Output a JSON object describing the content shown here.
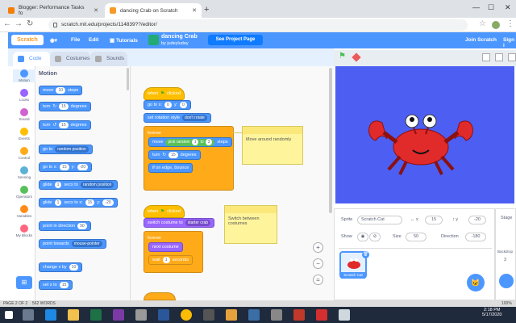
{
  "browser": {
    "tabs": [
      {
        "label": "Blogger: Performance Tasks fo"
      },
      {
        "label": "dancing Crab on Scratch"
      }
    ],
    "new_tab": "+",
    "url": "scratch.mit.edu/projects/114839??/editor/"
  },
  "scratch": {
    "logo": "Scratch",
    "menu": {
      "file": "File",
      "edit": "Edit",
      "tutorials": "Tutorials",
      "join": "Join Scratch",
      "signin": "Sign i"
    },
    "project_title": "dancing Crab",
    "project_author": "by judeyludey",
    "see_project": "See Project Page",
    "tabs": {
      "code": "Code",
      "costumes": "Costumes",
      "sounds": "Sounds"
    },
    "categories": [
      {
        "label": "Motion",
        "color": "#4c97ff"
      },
      {
        "label": "Looks",
        "color": "#9966ff"
      },
      {
        "label": "Sound",
        "color": "#cf63cf"
      },
      {
        "label": "Events",
        "color": "#ffbf00"
      },
      {
        "label": "Control",
        "color": "#ffab19"
      },
      {
        "label": "Sensing",
        "color": "#5cb1d6"
      },
      {
        "label": "Operators",
        "color": "#59c059"
      },
      {
        "label": "Variables",
        "color": "#ff8c1a"
      },
      {
        "label": "My Blocks",
        "color": "#ff6680"
      }
    ],
    "palette_title": "Motion",
    "palette": {
      "move": "move",
      "move_val": "10",
      "steps": "steps",
      "turn": "turn",
      "turn_r": "15",
      "degrees": "degrees",
      "turn_l_val": "15",
      "goto": "go to",
      "goto_dd": "random position",
      "gotoxy": "go to x:",
      "gx": "15",
      "y": "y:",
      "gy": "-20",
      "glide": "glide",
      "glide_s": "1",
      "secs_to": "secs to",
      "glide_dd": "random position",
      "glide2": "glide",
      "glide2_s": "1",
      "secs_to_x": "secs to x:",
      "g2x": "15",
      "g2y": "-20",
      "point_dir": "point in direction",
      "point_val": "90",
      "point_towards": "point towards",
      "pt_dd": "mouse-pointer",
      "change_x": "change x by",
      "cx": "10",
      "set_x": "set x to",
      "sx": "15"
    },
    "script1": {
      "hat": "when",
      "hat2": "clicked",
      "goto": "go to x:",
      "x": "0",
      "y": "y:",
      "yv": "0",
      "rot": "set rotation style",
      "rot_dd": "don't rotate",
      "forever": "forever",
      "move": "move",
      "pick": "pick random",
      "p1": "1",
      "to": "to",
      "p2": "3",
      "steps": "steps",
      "turn": "turn",
      "tv": "15",
      "deg": "degrees",
      "bounce": "if on edge, bounce"
    },
    "note1": "Move around randomly",
    "script2": {
      "hat": "when",
      "hat2": "clicked",
      "switch": "switch costume to",
      "sw_dd": "starter crab",
      "forever": "forever",
      "next": "next costume",
      "wait": "wait",
      "wv": "1",
      "secs": "seconds"
    },
    "note2": "Switch between costumes",
    "sprite": {
      "sprite_label": "Sprite",
      "sprite_name": "Scratch Cat",
      "x_label": "x",
      "x": "15",
      "y_label": "y",
      "y": "-20",
      "show_label": "Show",
      "size_label": "Size",
      "size": "50",
      "dir_label": "Direction",
      "direction": "-180",
      "thumb_label": "Scratch Cat"
    },
    "stage_pane": {
      "label": "Stage",
      "backdrops": "Backdrop",
      "count": "3"
    }
  },
  "statusbar": {
    "page": "PAGE 2 OF 2",
    "words": "562 WORDS",
    "zoom": "100%"
  },
  "taskbar": {
    "time": "2:18 PM",
    "date": "5/17/2020"
  }
}
